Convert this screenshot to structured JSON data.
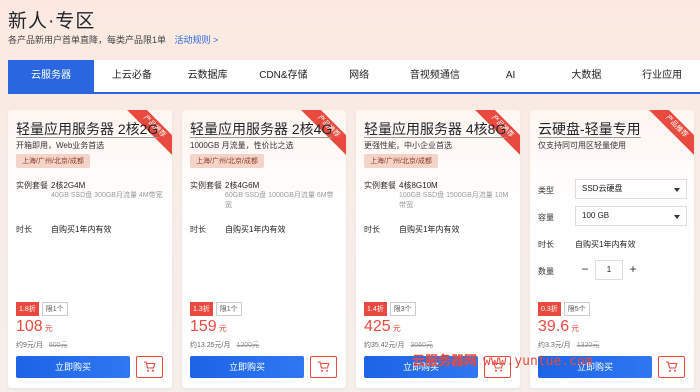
{
  "header": {
    "title": "新人·专区",
    "subtitle": "各产品新用户首单直降，每类产品限1单",
    "rules_link": "活动规则 >"
  },
  "tabs": [
    "云服务器",
    "上云必备",
    "云数据库",
    "CDN&存储",
    "网络",
    "音视频通信",
    "AI",
    "大数据",
    "行业应用"
  ],
  "active_tab": 0,
  "cards": [
    {
      "ribbon": "产品推荐",
      "title": "轻量应用服务器 2核2G",
      "desc": "开箱即用，Web业务首选",
      "region": "上海/广州/北京/成都",
      "spec_label": "实例套餐",
      "spec_main": "2核2G4M",
      "spec_sub": "40GB SSD盘 300GB月流量 4M带宽",
      "duration_label": "时长",
      "duration": "自购买1年内有效",
      "discount": "1.8折",
      "limit": "限1个",
      "price": "108",
      "price_unit": "元",
      "per_month": "约9元/月",
      "original": "600元",
      "buy_label": "立即购买"
    },
    {
      "ribbon": "产品推荐",
      "title": "轻量应用服务器 2核4G",
      "desc": "1000GB 月流量，性价比之选",
      "region": "上海/广州/北京/成都",
      "spec_label": "实例套餐",
      "spec_main": "2核4G6M",
      "spec_sub": "60GB SSD盘 1000GB月流量 6M带宽",
      "duration_label": "时长",
      "duration": "自购买1年内有效",
      "discount": "1.3折",
      "limit": "限1个",
      "price": "159",
      "price_unit": "元",
      "per_month": "约13.25元/月",
      "original": "1200元",
      "buy_label": "立即购买"
    },
    {
      "ribbon": "产品推荐",
      "title": "轻量应用服务器 4核8G",
      "desc": "更强性能，中小企业首选",
      "region": "上海/广州/北京/成都",
      "spec_label": "实例套餐",
      "spec_main": "4核8G10M",
      "spec_sub": "100GB SSD盘 1500GB月流量 10M带宽",
      "duration_label": "时长",
      "duration": "自购买1年内有效",
      "discount": "1.4折",
      "limit": "限3个",
      "price": "425",
      "price_unit": "元",
      "per_month": "约35.42元/月",
      "original": "3060元",
      "buy_label": "立即购买"
    },
    {
      "ribbon": "产品推荐",
      "title": "云硬盘-轻量专用",
      "desc": "仅支持同可用区轻量使用",
      "type_label": "类型",
      "type_value": "SSD云硬盘",
      "capacity_label": "容量",
      "capacity_value": "100 GB",
      "duration_label": "时长",
      "duration": "自购买1年内有效",
      "quantity_label": "数量",
      "quantity": "1",
      "discount": "0.3折",
      "limit": "限5个",
      "price": "39.6",
      "price_unit": "元",
      "per_month": "约3.3元/月",
      "original": "1320元",
      "buy_label": "立即购买"
    }
  ],
  "watermark": {
    "cn": "云服务器网",
    "en": "www.yuntue.com"
  },
  "colors": {
    "accent": "#2a66e0",
    "price": "#e94a3f"
  }
}
